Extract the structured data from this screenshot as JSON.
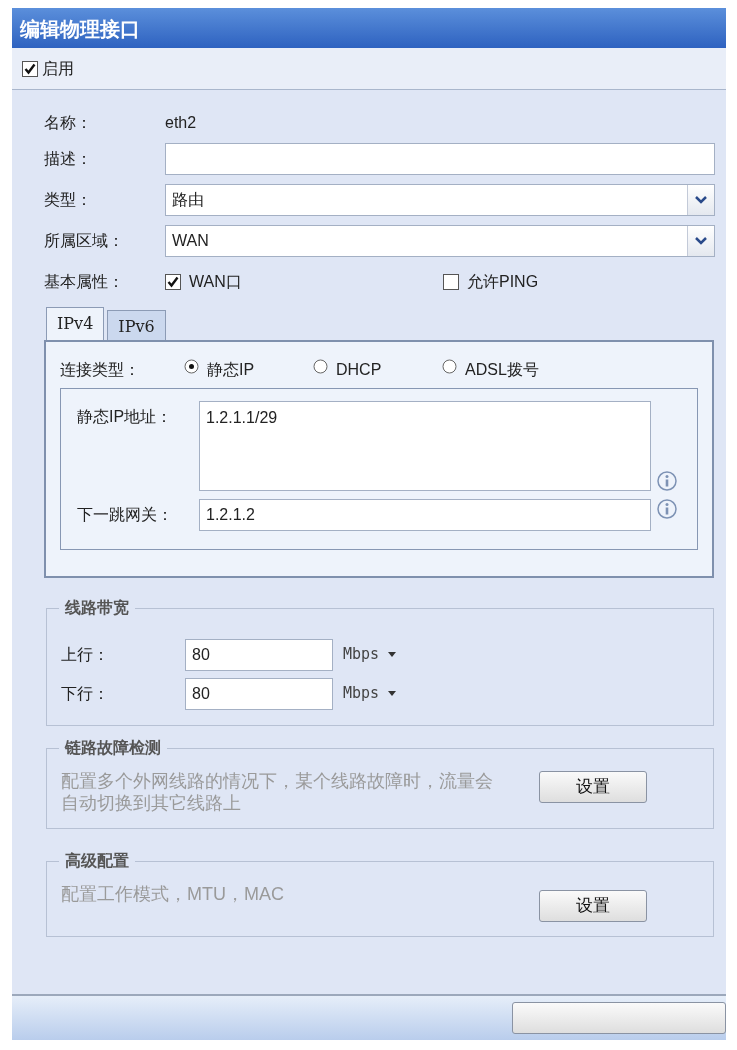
{
  "window": {
    "title": "编辑物理接口"
  },
  "enable": {
    "label": "启用",
    "checked": true
  },
  "fields": [
    {
      "kind": "text",
      "label": "名称：",
      "value": "eth2"
    },
    {
      "kind": "input",
      "label": "描述："
    },
    {
      "kind": "select",
      "label": "类型：",
      "value": "路由"
    },
    {
      "kind": "select",
      "label": "所属区域：",
      "value": "WAN"
    }
  ],
  "basic_properties": {
    "label": "基本属性：",
    "options": [
      {
        "label": "WAN口",
        "checked": true
      },
      {
        "label": "允许PING",
        "checked": false
      }
    ]
  },
  "tabs": [
    {
      "label": "IPv4",
      "selected": true
    },
    {
      "label": "IPv6",
      "selected": false
    }
  ],
  "connection_type": {
    "label": "连接类型：",
    "options": [
      {
        "label": "静态IP",
        "selected": true
      },
      {
        "label": "DHCP",
        "selected": false
      },
      {
        "label": "ADSL拨号",
        "selected": false
      }
    ]
  },
  "static_fields": [
    {
      "kind": "textarea",
      "label": "静态IP地址：",
      "value": "1.2.1.1/29"
    },
    {
      "kind": "input",
      "label": "下一跳网关：",
      "value": "1.2.1.2"
    }
  ],
  "bandwidth": {
    "title": "线路带宽",
    "rows": [
      {
        "label": "上行：",
        "value": "80",
        "unit": "Mbps"
      },
      {
        "label": "下行：",
        "value": "80",
        "unit": "Mbps"
      }
    ]
  },
  "sections": [
    {
      "title": "链路故障检测",
      "description": "配置多个外网线路的情况下，某个线路故障时，流量会自动切换到其它线路上",
      "button": "设置"
    },
    {
      "title": "高级配置",
      "description": "配置工作模式，MTU，MAC",
      "button": "设置"
    }
  ]
}
